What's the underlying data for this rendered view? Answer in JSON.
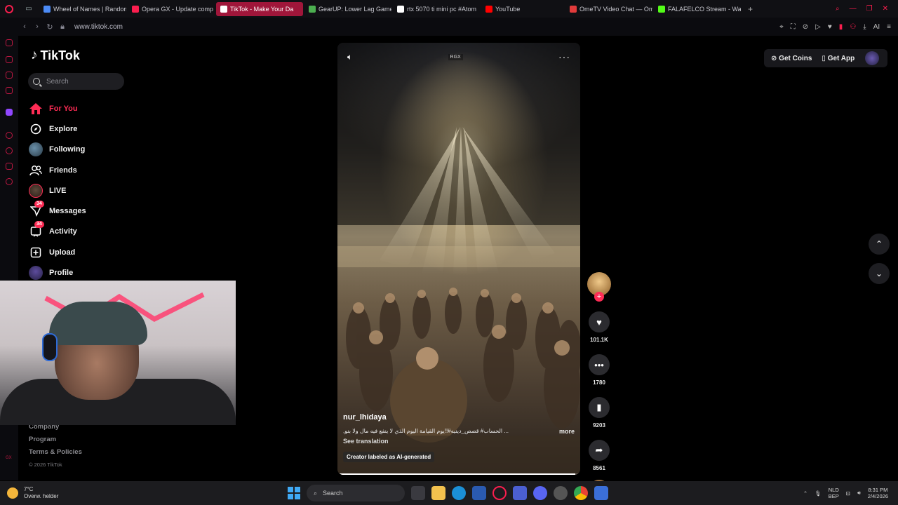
{
  "browser": {
    "tabs": [
      {
        "label": "Wheel of Names | Random",
        "color": "#4c8bf5"
      },
      {
        "label": "Opera GX - Update comp",
        "color": "#fa1e4e"
      },
      {
        "label": "TikTok - Make Your Da",
        "color": "#ffffff",
        "active": true
      },
      {
        "label": "GearUP: Lower Lag Game",
        "color": "#4caf50"
      },
      {
        "label": "rtx 5070 ti mini pc #Atom",
        "color": "#ffffff"
      },
      {
        "label": "YouTube",
        "color": "#ff0000"
      },
      {
        "label": "OmeTV Video Chat — Om",
        "color": "#e23b3b"
      },
      {
        "label": "FALAFELCO Stream - Watc",
        "color": "#53fc18"
      }
    ],
    "url": "www.tiktok.com",
    "ai_label": "AI"
  },
  "tiktok": {
    "logo": "TikTok",
    "search_placeholder": "Search",
    "nav": [
      {
        "label": "For You",
        "icon": "home-icon",
        "active": true
      },
      {
        "label": "Explore",
        "icon": "compass-icon"
      },
      {
        "label": "Following",
        "icon": "following-avatar"
      },
      {
        "label": "Friends",
        "icon": "friends-icon"
      },
      {
        "label": "LIVE",
        "icon": "live-avatar"
      },
      {
        "label": "Messages",
        "icon": "messages-icon",
        "badge": "34"
      },
      {
        "label": "Activity",
        "icon": "activity-icon",
        "badge": "34"
      },
      {
        "label": "Upload",
        "icon": "upload-icon"
      },
      {
        "label": "Profile",
        "icon": "profile-avatar"
      }
    ],
    "footer": {
      "company": "Company",
      "program": "Program",
      "terms": "Terms & Policies",
      "copyright": "© 2026 TikTok"
    },
    "header": {
      "get_coins": "Get Coins",
      "get_app": "Get App"
    },
    "video": {
      "watermark": "RGX",
      "username": "nur_lhidaya",
      "caption": "... الحساب# قصص_دينيه#!!يوم القيامة اليوم الذي لا ينفع فيه مال ولا بنو,",
      "more": "more",
      "see_translation": "See translation",
      "ai_label": "Creator labeled as AI-generated",
      "progress": 0.98
    },
    "actions": {
      "likes": "101.1K",
      "comments": "1780",
      "saves": "9203",
      "shares": "8561"
    }
  },
  "taskbar": {
    "temperature": "7°C",
    "weather": "Overw. helder",
    "search": "Search",
    "language_top": "NLD",
    "language_bottom": "BEP",
    "time": "8:31 PM",
    "date": "2/4/2026"
  }
}
